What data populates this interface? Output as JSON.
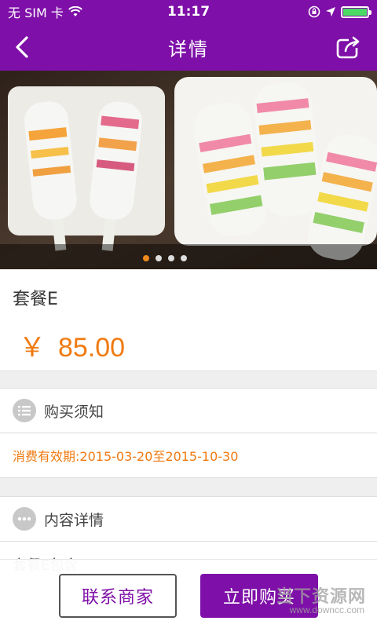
{
  "status_bar": {
    "carrier": "无 SIM 卡",
    "time": "11:17"
  },
  "nav": {
    "title": "详情"
  },
  "banner": {
    "page_count": 4,
    "active_index": 0
  },
  "product": {
    "name": "套餐E",
    "currency": "￥",
    "price": "85.00"
  },
  "purchase_notes": {
    "label": "购买须知",
    "validity_label": "消费有效期:",
    "validity_value": "2015-03-20至2015-10-30"
  },
  "content_details": {
    "label": "内容详情",
    "text": "套餐E包含"
  },
  "actions": {
    "contact_label": "联系商家",
    "buy_label": "立即购买"
  },
  "watermark": {
    "main": "当下资源网",
    "sub": "www.downcc.com"
  },
  "colors": {
    "brand": "#7e0fa8",
    "price": "#f07a10"
  }
}
